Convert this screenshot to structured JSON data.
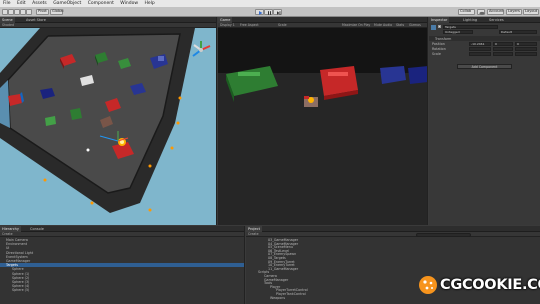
{
  "menu": [
    "File",
    "Edit",
    "Assets",
    "GameObject",
    "Component",
    "Window",
    "Help"
  ],
  "toolbar": {
    "pivot": "Pivot",
    "space": "Global",
    "collab": "Collab",
    "account": "Account",
    "layers": "Layers",
    "layout": "Layout"
  },
  "scene": {
    "tab_scene": "Scene",
    "tab_asset_store": "Asset Store",
    "shading": "Shaded"
  },
  "game": {
    "tab": "Game",
    "display": "Display 1",
    "aspect": "Free Aspect",
    "scale": "Scale",
    "maximize": "Maximize On Play",
    "mute": "Mute Audio",
    "stats": "Stats",
    "gizmos": "Gizmos"
  },
  "inspector": {
    "tab": "Inspector",
    "tab2": "Lighting",
    "tab3": "Services",
    "object_name": "Targets",
    "tag_label": "Untagged",
    "layer_label": "Default",
    "component": "Transform",
    "position_label": "Position",
    "rotation_label": "Rotation",
    "scale_label": "Scale",
    "x_value": "-10.2461",
    "y_value": "0",
    "z_value": "0",
    "add_component": "Add Component"
  },
  "hierarchy": {
    "tab": "Hierarchy",
    "tab2": "Console",
    "create": "Create",
    "rows": [
      "Main Camera",
      "Environment",
      "UI",
      "Directional Light",
      "EventSystem",
      "GameManager",
      "Targets",
      "Sphere",
      "Sphere (1)",
      "Sphere (2)",
      "Sphere (3)",
      "Sphere (4)",
      "Sphere (5)"
    ]
  },
  "project": {
    "tab": "Project",
    "create": "Create",
    "tree": [
      "03_GameManager",
      "04_GameManager",
      "05_SceneMenu",
      "06_TestLevel",
      "07_EnemySpawn",
      "08_Targets",
      "09_EnemyTurret",
      "10_EnemyTurret",
      "11_GameManager",
      "Scripts",
      "Camera",
      "GameManager",
      "Tools",
      "Player",
      "PlayerTurretControl",
      "PlayerTankControl",
      "Weapons"
    ]
  },
  "brand": {
    "text": "CGCOOKIE.COM"
  }
}
